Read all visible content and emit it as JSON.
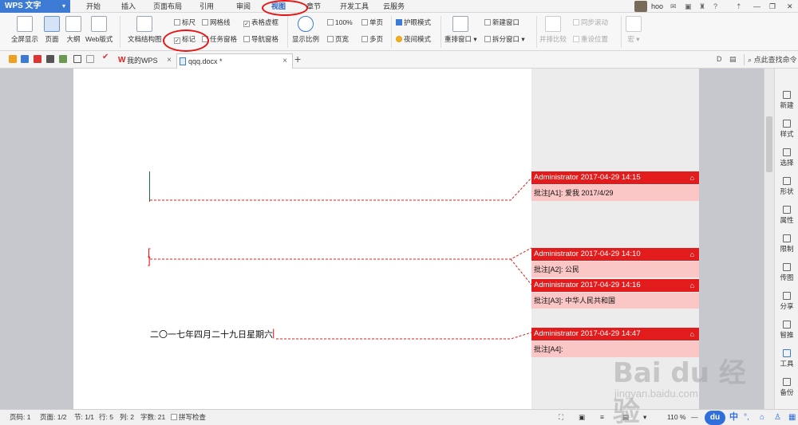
{
  "app": {
    "name": "WPS 文字"
  },
  "menu": {
    "tabs": [
      "开始",
      "插入",
      "页面布局",
      "引用",
      "审阅",
      "视图",
      "章节",
      "开发工具",
      "云服务"
    ],
    "active": "视图"
  },
  "titlebar": {
    "user": "hoo",
    "help": "?"
  },
  "ribbon": {
    "fullscreen": "全屏显示",
    "page": "页面",
    "outline": "大纲",
    "web": "Web版式",
    "doc_structure": "文档结构图",
    "ruler": "标尺",
    "gridlines": "网格线",
    "table_borders": "表格虚框",
    "markup": "标记",
    "task_pane": "任务窗格",
    "nav_pane": "导航窗格",
    "zoom": "显示比例",
    "zoom_100": "100%",
    "single_page": "单页",
    "page_width": "页宽",
    "multi_page": "多页",
    "eye_care": "护眼模式",
    "night_mode": "夜间模式",
    "rearrange": "重排窗口",
    "new_window": "新建窗口",
    "split_window": "拆分窗口",
    "side_by_side": "并排比较",
    "sync_scroll": "同步滚动",
    "reset_position": "重设位置",
    "macro": "宏"
  },
  "tabs": {
    "home": "我的WPS",
    "doc": "qqq.docx *",
    "search_placeholder": "点此查找命令"
  },
  "document": {
    "date_text": "二〇一七年四月二十九日星期六"
  },
  "comments": [
    {
      "header": "Administrator 2017-04-29 14:15",
      "body": "批注[A1]: 爱我 2017/4/29"
    },
    {
      "header": "Administrator 2017-04-29 14:10",
      "body": "批注[A2]: 公民"
    },
    {
      "header": "Administrator 2017-04-29 14:16",
      "body": "批注[A3]: 中华人民共和国"
    },
    {
      "header": "Administrator 2017-04-29 14:47",
      "body": "批注[A4]:"
    }
  ],
  "side_panel": [
    "新建",
    "样式",
    "选择",
    "形状",
    "属性",
    "限制",
    "传图",
    "分享",
    "智推",
    "工具",
    "备份"
  ],
  "status": {
    "page_no": "页码: 1",
    "pages": "页面: 1/2",
    "section": "节: 1/1",
    "row": "行: 5",
    "col": "列: 2",
    "words": "字数: 21",
    "spell": "拼写检查",
    "zoom": "110 %"
  },
  "watermark": {
    "brand": "Bai du 经验",
    "url": "jingyan.baidu.com"
  },
  "ime": {
    "du": "du",
    "lang": "中"
  },
  "colors": {
    "accent": "#3d7ad4",
    "comment_header": "#e21c1c",
    "comment_body": "#fbc6c6",
    "annotation": "#e81414"
  }
}
